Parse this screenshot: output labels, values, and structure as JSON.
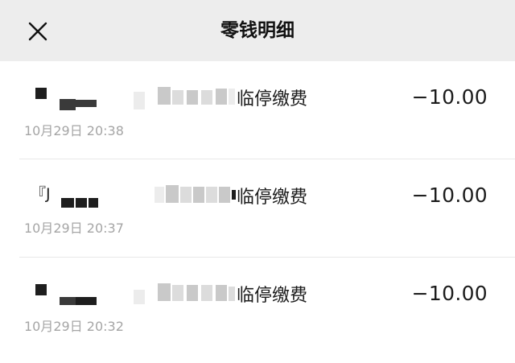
{
  "header": {
    "title": "零钱明细",
    "close_icon": "close-icon"
  },
  "transactions": [
    {
      "prefix": "",
      "description": "临停缴费",
      "time": "10月29日 20:38",
      "amount": "−10.00"
    },
    {
      "prefix": "『J",
      "description": "临停缴费",
      "time": "10月29日 20:37",
      "amount": "−10.00"
    },
    {
      "prefix": "",
      "description": "临停缴费",
      "time": "10月29日 20:32",
      "amount": "−10.00"
    }
  ],
  "colors": {
    "header_bg": "#ededed",
    "page_bg": "#ffffff",
    "time_text": "#a5a5a5",
    "divider": "#e8e8e8"
  }
}
